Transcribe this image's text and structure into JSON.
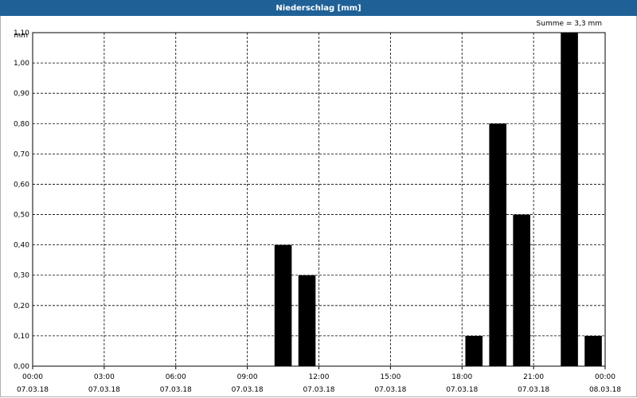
{
  "window": {
    "title": "Niederschlag [mm]"
  },
  "chart_data": {
    "type": "bar",
    "title": "Niederschlag [mm]",
    "annotation": "Summe = 3,3 mm",
    "ylabel": "mm",
    "xlabel": "",
    "ylim": [
      0,
      1.1
    ],
    "yticks": [
      "0,00",
      "0,10",
      "0,20",
      "0,30",
      "0,40",
      "0,50",
      "0,60",
      "0,70",
      "0,80",
      "0,90",
      "1,00",
      "1,10"
    ],
    "xlim_hours": [
      0,
      24
    ],
    "xticks": [
      {
        "time": "00:00",
        "date": "07.03.18"
      },
      {
        "time": "03:00",
        "date": "07.03.18"
      },
      {
        "time": "06:00",
        "date": "07.03.18"
      },
      {
        "time": "09:00",
        "date": "07.03.18"
      },
      {
        "time": "12:00",
        "date": "07.03.18"
      },
      {
        "time": "15:00",
        "date": "07.03.18"
      },
      {
        "time": "18:00",
        "date": "07.03.18"
      },
      {
        "time": "21:00",
        "date": "07.03.18"
      },
      {
        "time": "00:00",
        "date": "08.03.18"
      }
    ],
    "bars": [
      {
        "time": "10:00",
        "value": 0.4
      },
      {
        "time": "11:00",
        "value": 0.3
      },
      {
        "time": "18:00",
        "value": 0.1
      },
      {
        "time": "19:00",
        "value": 0.8
      },
      {
        "time": "20:00",
        "value": 0.5
      },
      {
        "time": "22:00",
        "value": 1.1
      },
      {
        "time": "23:00",
        "value": 0.1
      }
    ],
    "bar_color": "#000000",
    "grid": true
  }
}
